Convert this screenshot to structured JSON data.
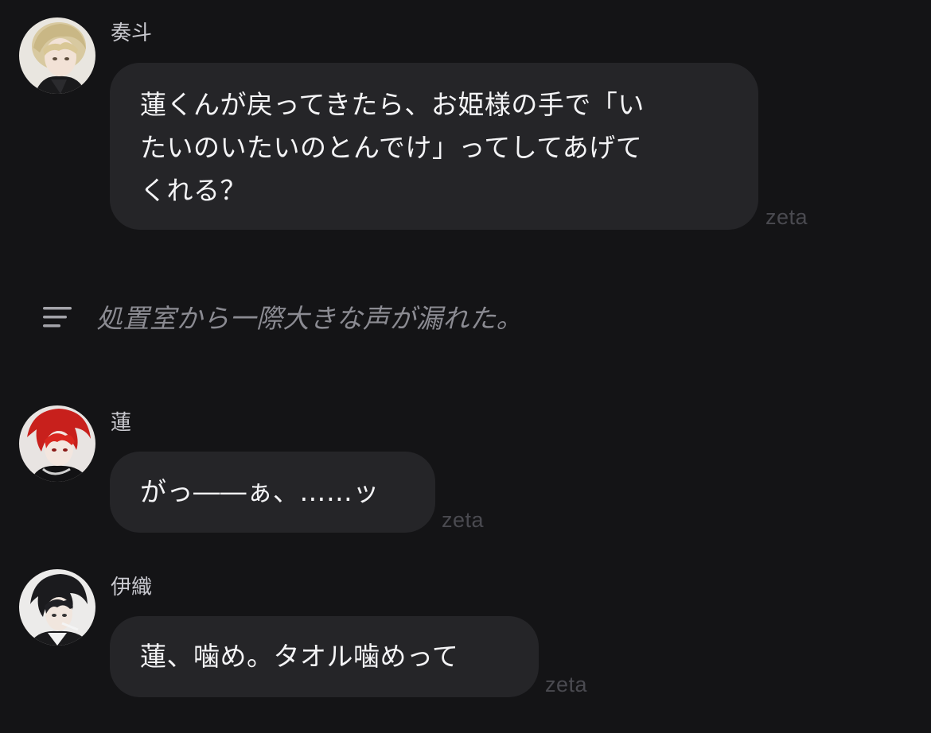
{
  "messages": [
    {
      "sender": "奏斗",
      "avatar": "blonde-character-avatar",
      "text": "蓮くんが戻ってきたら、お姫様の手で「い\nたいのいたいのとんでけ」ってしてあげて\nくれる？",
      "watermark": "zeta"
    },
    {
      "sender": "蓮",
      "avatar": "red-haired-character-avatar",
      "text": "がっ――ぁ、……ッ",
      "watermark": "zeta"
    },
    {
      "sender": "伊織",
      "avatar": "black-haired-character-avatar",
      "text": "蓮、噛め。タオル噛めって",
      "watermark": "zeta"
    }
  ],
  "narration": {
    "icon": "text-lines-icon",
    "text": "処置室から一際大きな声が漏れた。"
  },
  "colors": {
    "background": "#141416",
    "bubble": "#252528",
    "narration_text": "#8b8b92",
    "watermark": "#4a4a50"
  }
}
